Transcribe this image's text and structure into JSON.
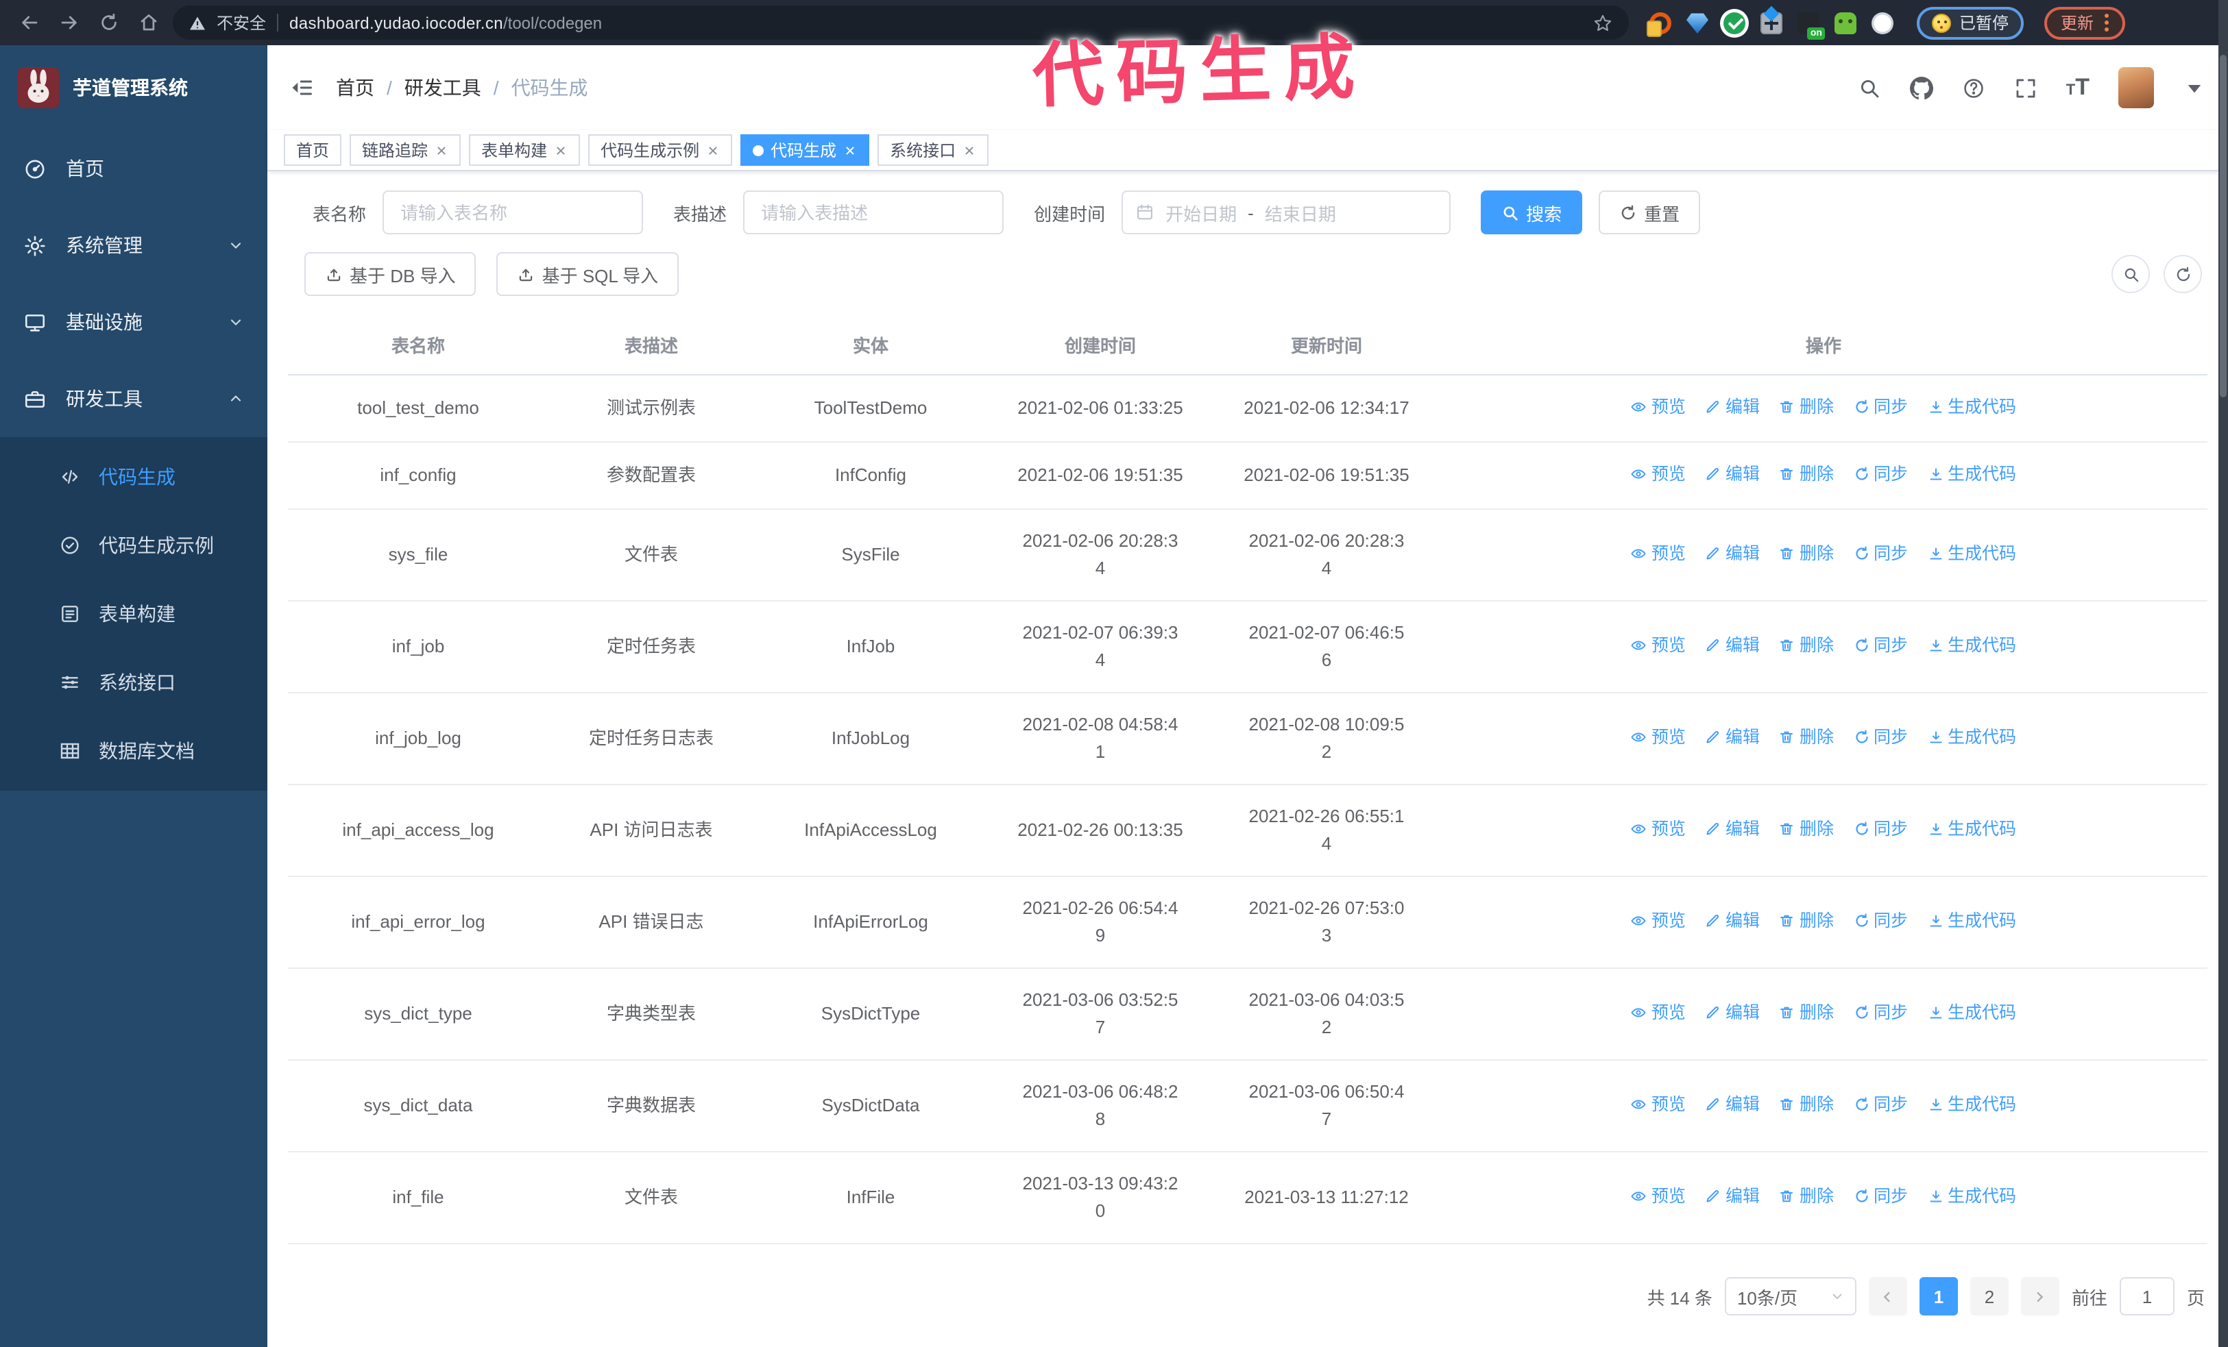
{
  "colors": {
    "accent": "#409eff",
    "sidebar_bg": "#24496a",
    "submenu_bg": "#1c3c59",
    "chrome_bg": "#232a35",
    "annotation": "#f5466d"
  },
  "browser": {
    "security_label": "不安全",
    "url_host": "dashboard.yudao.iocoder.cn",
    "url_path": "/tool/codegen",
    "extensions": [
      {
        "name": "orange-donut"
      },
      {
        "name": "blue-gem"
      },
      {
        "name": "green-check"
      },
      {
        "name": "grid"
      },
      {
        "name": "on-box",
        "badge": "on"
      },
      {
        "name": "green-robot"
      },
      {
        "name": "white-flower"
      }
    ],
    "paused_badge": "已暂停",
    "update_button": "更新"
  },
  "annotation": {
    "text": "代码生成"
  },
  "sidebar": {
    "logo_title": "芋道管理系统",
    "items": [
      {
        "label": "首页",
        "icon": "dashboard"
      },
      {
        "label": "系统管理",
        "icon": "gear",
        "chevron": "down"
      },
      {
        "label": "基础设施",
        "icon": "monitor",
        "chevron": "down"
      },
      {
        "label": "研发工具",
        "icon": "toolbox",
        "chevron": "up",
        "expanded": true,
        "children": [
          {
            "label": "代码生成",
            "icon": "code",
            "active": true
          },
          {
            "label": "代码生成示例",
            "icon": "check-circle"
          },
          {
            "label": "表单构建",
            "icon": "form"
          },
          {
            "label": "系统接口",
            "icon": "sliders"
          },
          {
            "label": "数据库文档",
            "icon": "table-grid"
          }
        ]
      }
    ]
  },
  "header": {
    "breadcrumb": [
      "首页",
      "研发工具",
      "代码生成"
    ],
    "separator": "/"
  },
  "tabs": [
    {
      "label": "首页",
      "closable": false,
      "active": false
    },
    {
      "label": "链路追踪",
      "closable": true,
      "active": false
    },
    {
      "label": "表单构建",
      "closable": true,
      "active": false
    },
    {
      "label": "代码生成示例",
      "closable": true,
      "active": false
    },
    {
      "label": "代码生成",
      "closable": true,
      "active": true
    },
    {
      "label": "系统接口",
      "closable": true,
      "active": false
    }
  ],
  "filters": {
    "name_label": "表名称",
    "name_placeholder": "请输入表名称",
    "desc_label": "表描述",
    "desc_placeholder": "请输入表描述",
    "time_label": "创建时间",
    "start_placeholder": "开始日期",
    "range_separator": "-",
    "end_placeholder": "结束日期",
    "search_label": "搜索",
    "reset_label": "重置"
  },
  "toolbar": {
    "import_db": "基于 DB 导入",
    "import_sql": "基于 SQL 导入"
  },
  "table": {
    "columns": [
      "表名称",
      "表描述",
      "实体",
      "创建时间",
      "更新时间",
      "操作"
    ],
    "row_actions": [
      {
        "label": "预览",
        "icon": "eye"
      },
      {
        "label": "编辑",
        "icon": "edit"
      },
      {
        "label": "删除",
        "icon": "trash"
      },
      {
        "label": "同步",
        "icon": "sync"
      },
      {
        "label": "生成代码",
        "icon": "download"
      }
    ],
    "rows": [
      {
        "name": "tool_test_demo",
        "desc": "测试示例表",
        "entity": "ToolTestDemo",
        "created": "2021-02-06 01:33:25",
        "updated": "2021-02-06 12:34:17"
      },
      {
        "name": "inf_config",
        "desc": "参数配置表",
        "entity": "InfConfig",
        "created": "2021-02-06 19:51:35",
        "updated": "2021-02-06 19:51:35"
      },
      {
        "name": "sys_file",
        "desc": "文件表",
        "entity": "SysFile",
        "created": "2021-02-06 20:28:3\n4",
        "updated": "2021-02-06 20:28:3\n4"
      },
      {
        "name": "inf_job",
        "desc": "定时任务表",
        "entity": "InfJob",
        "created": "2021-02-07 06:39:3\n4",
        "updated": "2021-02-07 06:46:5\n6"
      },
      {
        "name": "inf_job_log",
        "desc": "定时任务日志表",
        "entity": "InfJobLog",
        "created": "2021-02-08 04:58:4\n1",
        "updated": "2021-02-08 10:09:5\n2"
      },
      {
        "name": "inf_api_access_log",
        "desc": "API 访问日志表",
        "entity": "InfApiAccessLog",
        "created": "2021-02-26 00:13:35",
        "updated": "2021-02-26 06:55:1\n4"
      },
      {
        "name": "inf_api_error_log",
        "desc": "API 错误日志",
        "entity": "InfApiErrorLog",
        "created": "2021-02-26 06:54:4\n9",
        "updated": "2021-02-26 07:53:0\n3"
      },
      {
        "name": "sys_dict_type",
        "desc": "字典类型表",
        "entity": "SysDictType",
        "created": "2021-03-06 03:52:5\n7",
        "updated": "2021-03-06 04:03:5\n2"
      },
      {
        "name": "sys_dict_data",
        "desc": "字典数据表",
        "entity": "SysDictData",
        "created": "2021-03-06 06:48:2\n8",
        "updated": "2021-03-06 06:50:4\n7"
      },
      {
        "name": "inf_file",
        "desc": "文件表",
        "entity": "InfFile",
        "created": "2021-03-13 09:43:2\n0",
        "updated": "2021-03-13 11:27:12"
      }
    ]
  },
  "pagination": {
    "total": "共 14 条",
    "page_size": "10条/页",
    "pages": [
      "1",
      "2"
    ],
    "active_page": "1",
    "goto_label": "前往",
    "goto_value": "1",
    "goto_suffix": "页"
  }
}
